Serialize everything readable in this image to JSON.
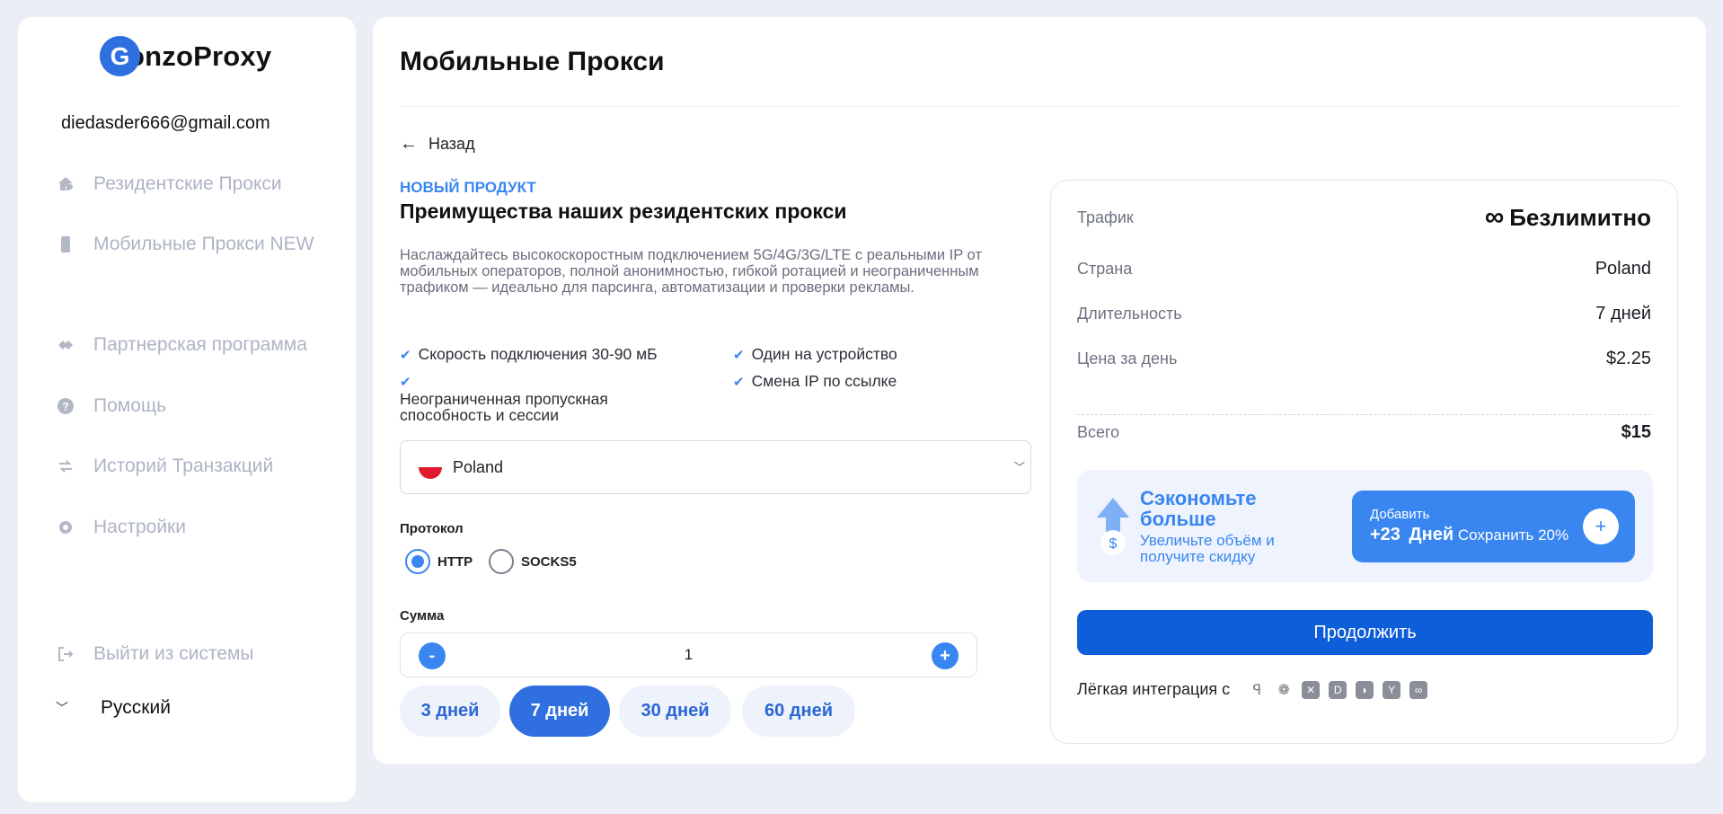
{
  "brand": {
    "logo_letter": "G",
    "logo_text": "onzoProxy"
  },
  "user": {
    "email": "diedasder666@gmail.com"
  },
  "sidebar": {
    "items": [
      {
        "label": "Резидентские Прокси",
        "icon": "house-user-icon"
      },
      {
        "label": "Мобильные Прокси NEW",
        "icon": "phone-icon"
      },
      {
        "label": "Партнерская программа",
        "icon": "handshake-icon"
      },
      {
        "label": "Помощь",
        "icon": "help-icon"
      },
      {
        "label": "Историй Транзакций",
        "icon": "transfer-icon"
      },
      {
        "label": "Настройки",
        "icon": "gear-icon"
      },
      {
        "label": "Выйти из системы",
        "icon": "logout-icon"
      }
    ],
    "language": "Русский"
  },
  "main": {
    "title": "Мобильные Прокси",
    "back_label": "Назад",
    "tag": "НОВЫЙ ПРОДУКТ",
    "subtitle": "Преимущества наших резидентских прокси",
    "description": "Наслаждайтесь высокоскоростным подключением 5G/4G/3G/LTE с реальными IP от мобильных операторов, полной анонимностью, гибкой ротацией и неограниченным трафиком — идеально для парсинга, автоматизации и проверки рекламы.",
    "features": [
      "Скорость подключения 30-90 мБ",
      "Неограниченная пропускная способность и сессии",
      "Один на устройство",
      "Смена IP по ссылке"
    ],
    "country": {
      "selected": "Poland"
    },
    "protocol": {
      "label": "Протокол",
      "options": [
        "HTTP",
        "SOCKS5"
      ],
      "selected": "HTTP"
    },
    "amount": {
      "label": "Сумма",
      "value": "1",
      "minus": "-",
      "plus": "+"
    },
    "durations": [
      "3 дней",
      "7 дней",
      "30 дней",
      "60 дней"
    ],
    "selected_duration": "7 дней"
  },
  "summary": {
    "traffic_label": "Трафик",
    "traffic_value": "Безлимитно",
    "infinity": "∞",
    "country_label": "Страна",
    "country_value": "Poland",
    "duration_label": "Длительность",
    "duration_value": "7 дней",
    "price_label": "Цена за день",
    "price_value": "$2.25",
    "total_label": "Всего",
    "total_value": "$15",
    "promo": {
      "title": "Сэкономьте больше",
      "text": "Увеличьте объём и получите скидку",
      "btn_small": "Добавить",
      "btn_amount": "+23",
      "btn_unit": "Дней",
      "btn_save": "Сохранить 20%"
    },
    "continue_label": "Продолжить",
    "integration_label": "Лёгкая интеграция с"
  },
  "colors": {
    "accent": "#3a86f0",
    "primary": "#0f5ed9",
    "muted": "#aeb4c4"
  }
}
